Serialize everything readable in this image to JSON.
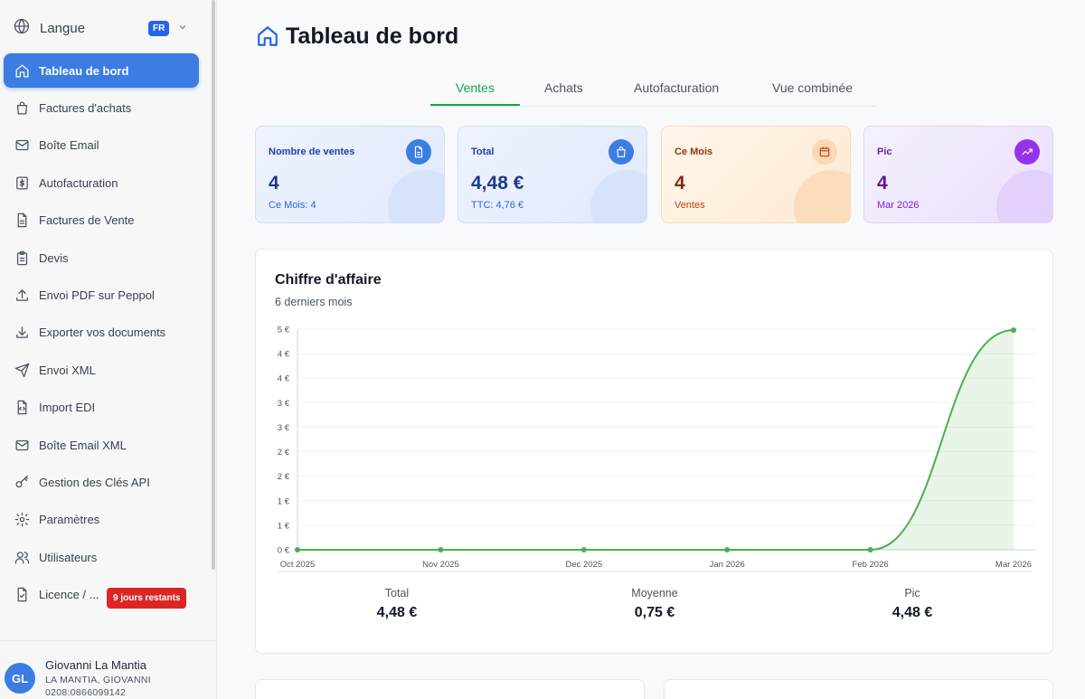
{
  "sidebar": {
    "language_label": "Langue",
    "language_code": "FR",
    "items": [
      {
        "label": "Tableau de bord",
        "icon": "home-icon"
      },
      {
        "label": "Factures d'achats",
        "icon": "shopping-bag-icon"
      },
      {
        "label": "Boîte Email",
        "icon": "mail-icon"
      },
      {
        "label": "Autofacturation",
        "icon": "dollar-icon"
      },
      {
        "label": "Factures de Vente",
        "icon": "file-icon"
      },
      {
        "label": "Devis",
        "icon": "clipboard-icon"
      },
      {
        "label": "Envoi PDF sur Peppol",
        "icon": "upload-icon"
      },
      {
        "label": "Exporter vos documents",
        "icon": "download-icon"
      },
      {
        "label": "Envoi XML",
        "icon": "send-icon"
      },
      {
        "label": "Import EDI",
        "icon": "file-code-icon"
      },
      {
        "label": "Boîte Email XML",
        "icon": "mail-icon"
      },
      {
        "label": "Gestion des Clés API",
        "icon": "key-icon"
      },
      {
        "label": "Paramètres",
        "icon": "gear-icon"
      },
      {
        "label": "Utilisateurs",
        "icon": "users-icon"
      },
      {
        "label": "Licence / ...",
        "icon": "file-check-icon"
      }
    ],
    "trial_badge": "9 jours restants",
    "user": {
      "initials": "GL",
      "name": "Giovanni La Mantia",
      "company": "LA MANTIA, GIOVANNI",
      "id": "0208:0866099142"
    }
  },
  "main": {
    "title": "Tableau de bord",
    "tabs": [
      "Ventes",
      "Achats",
      "Autofacturation",
      "Vue combinée"
    ],
    "active_tab": "Ventes",
    "stats": [
      {
        "label": "Nombre de ventes",
        "value": "4",
        "sub": "Ce Mois: 4",
        "icon": "document-icon",
        "color": "#2563eb"
      },
      {
        "label": "Total",
        "value": "4,48 €",
        "sub": "TTC: 4,76 €",
        "icon": "shopping-bag-icon",
        "color": "#2563eb"
      },
      {
        "label": "Ce Mois",
        "value": "4",
        "sub": "Ventes",
        "icon": "calendar-icon",
        "color": "#c2410c"
      },
      {
        "label": "Pic",
        "value": "4",
        "sub": "Mar 2026",
        "icon": "trending-up-icon",
        "color": "#7c3aed"
      }
    ],
    "chart_card": {
      "title": "Chiffre d'affaire",
      "subtitle": "6 derniers mois",
      "summary": [
        {
          "label": "Total",
          "value": "4,48 €"
        },
        {
          "label": "Moyenne",
          "value": "0,75 €"
        },
        {
          "label": "Pic",
          "value": "4,48 €"
        }
      ]
    }
  },
  "chart_data": {
    "type": "area",
    "categories": [
      "Oct 2025",
      "Nov 2025",
      "Dec 2025",
      "Jan 2026",
      "Feb 2026",
      "Mar 2026"
    ],
    "values": [
      0,
      0,
      0,
      0,
      0,
      4.48
    ],
    "ylim": [
      0,
      4.5
    ],
    "yticks": [
      0,
      0.5,
      1,
      1.5,
      2,
      2.5,
      3,
      3.5,
      4,
      4.5
    ],
    "ytick_labels": [
      "0 €",
      "1 €",
      "1 €",
      "2 €",
      "2 €",
      "3 €",
      "3 €",
      "4 €",
      "4 €",
      "5 €"
    ],
    "color": "#4caf50",
    "grid": true,
    "smooth": true
  }
}
